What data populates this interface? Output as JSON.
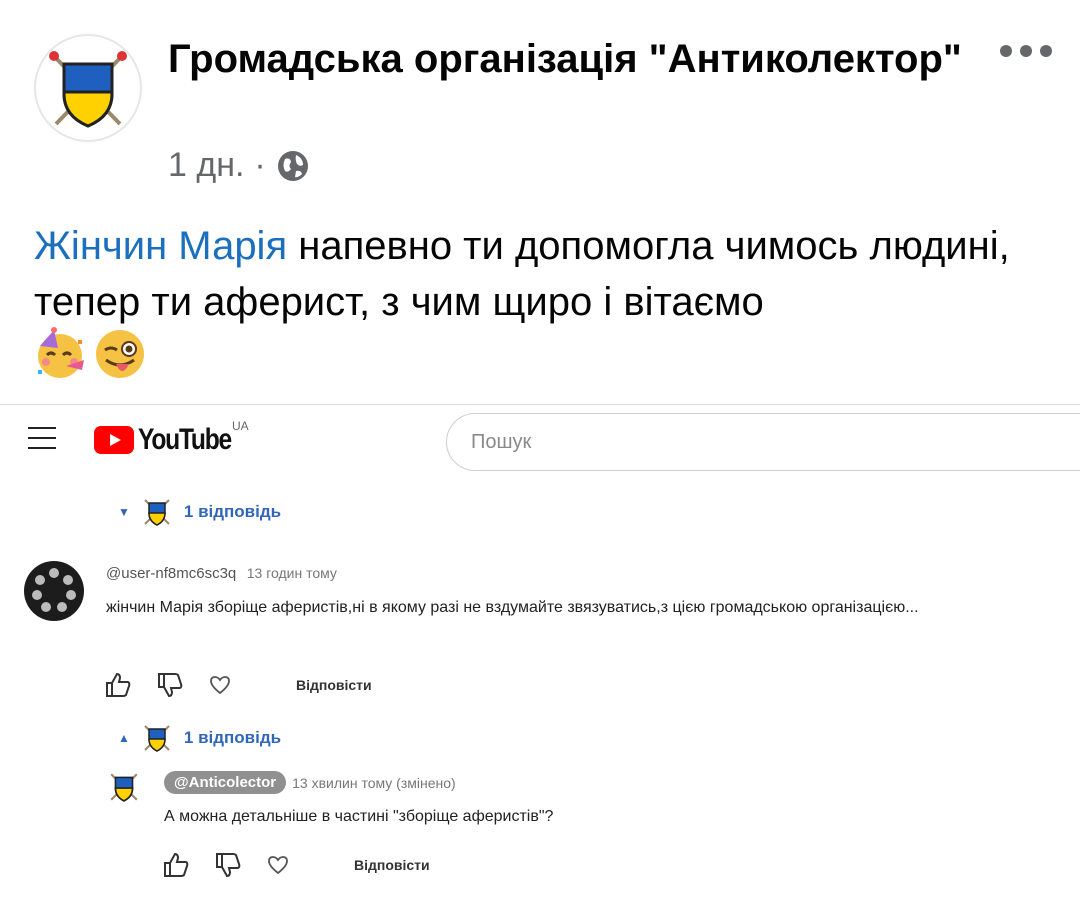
{
  "post": {
    "page_name": "Громадська організація \"Антиколектор\"",
    "time": "1 дн.",
    "separator": "·",
    "mention": "Жінчин Марія",
    "text": "напевно ти допомогла чимось людині, тепер ти аферист, з чим щиро і вітаємо",
    "emojis": [
      "partying-face",
      "winking-face-with-tongue"
    ],
    "icons": {
      "audience": "globe-icon",
      "more": "more-options-icon"
    }
  },
  "youtube": {
    "logo_text": "YouTube",
    "region": "UA",
    "search_placeholder": "Пошук",
    "thread_top": {
      "replies_label": "1 відповідь"
    },
    "comment": {
      "author": "@user-nf8mc6sc3q",
      "time": "13 годин тому",
      "text": "жінчин Марія зборіще аферистів,ні в якому разі не вздумайте звязуватись,з цією громадською організацією...",
      "reply_label": "Відповісти",
      "replies_label": "1 відповідь"
    },
    "reply": {
      "author": "@Anticolector",
      "time": "13 хвилин тому (змінено)",
      "text": "А можна детальніше в частині \"зборіще аферистів\"?",
      "reply_label": "Відповісти"
    }
  },
  "colors": {
    "mention": "#1b6fbd",
    "secondary_text": "#65676b",
    "yt_red": "#ff0000",
    "yt_link": "#3166b8",
    "chip_bg": "#909090",
    "flag_blue": "#1f5fbf",
    "flag_yellow": "#ffd100"
  }
}
